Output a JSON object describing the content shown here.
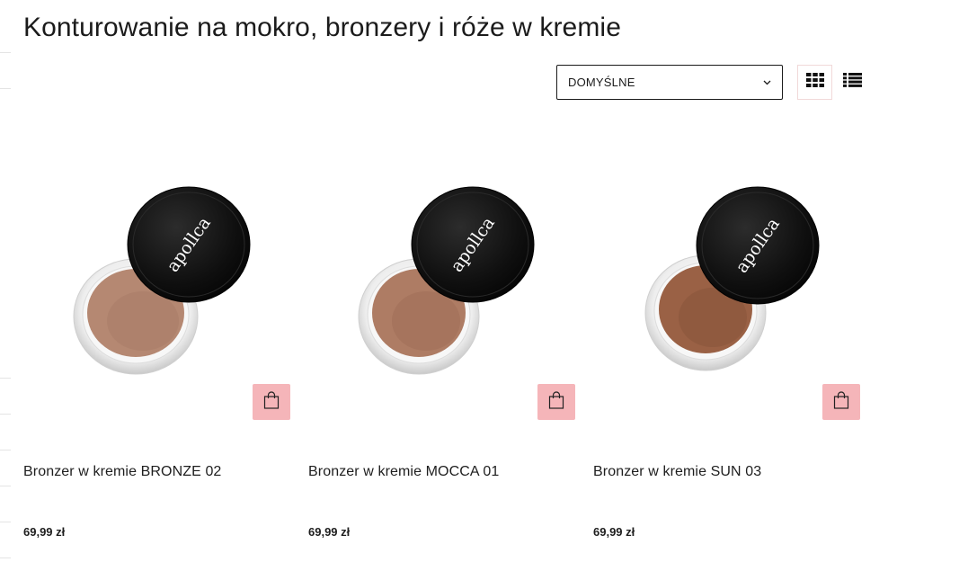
{
  "page_title": "Konturowanie na mokro, bronzery i róże w kremie",
  "toolbar": {
    "sort_value": "DOMYŚLNE"
  },
  "colors": {
    "cart_button": "#f5b5b9",
    "text": "#1e1e1e",
    "lid": "#121212"
  },
  "products": [
    {
      "name": "Bronzer w kremie BRONZE 02",
      "price": "69,99 zł",
      "brand_on_lid": "apollca",
      "cream_color": "#b58872",
      "cream_shade": "#a07560"
    },
    {
      "name": "Bronzer w kremie MOCCA 01",
      "price": "69,99 zł",
      "brand_on_lid": "apollca",
      "cream_color": "#ae7c64",
      "cream_shade": "#976650"
    },
    {
      "name": "Bronzer w kremie SUN 03",
      "price": "69,99 zł",
      "brand_on_lid": "apollca",
      "cream_color": "#9a6145",
      "cream_shade": "#7f4c34"
    }
  ]
}
